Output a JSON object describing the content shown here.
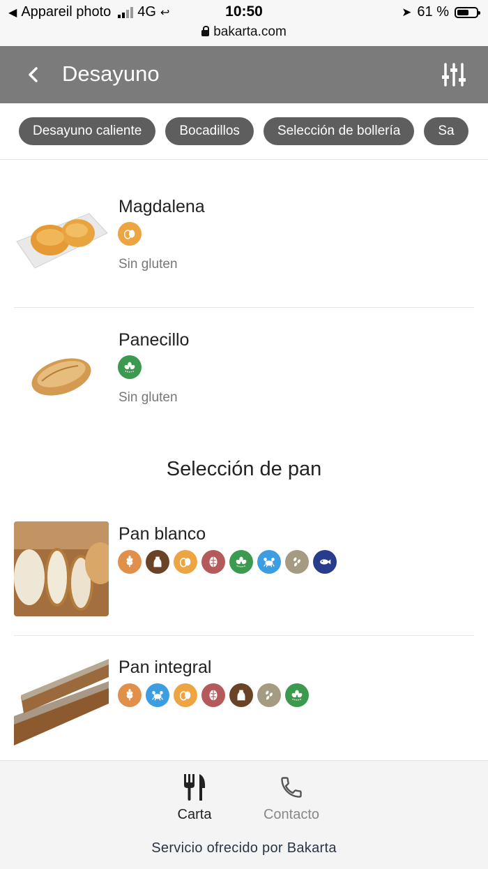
{
  "status_bar": {
    "carrier": "Appareil photo",
    "network": "4G",
    "time": "10:50",
    "battery": "61 %",
    "battery_level": 0.61,
    "url": "bakarta.com"
  },
  "header": {
    "title": "Desayuno"
  },
  "chips": [
    "Desayuno caliente",
    "Bocadillos",
    "Selección de bollería",
    "Sa"
  ],
  "items_top": [
    {
      "name": "Magdalena",
      "note": "Sin gluten",
      "allergens": [
        "egg"
      ]
    },
    {
      "name": "Panecillo",
      "note": "Sin gluten",
      "allergens": [
        "lupin"
      ]
    }
  ],
  "section_title": "Selección de pan",
  "items_pan": [
    {
      "name": "Pan blanco",
      "allergens": [
        "gluten",
        "milk",
        "egg",
        "nuts",
        "lupin",
        "crustacean",
        "sesame",
        "fish"
      ]
    },
    {
      "name": "Pan integral",
      "allergens": [
        "gluten",
        "crustacean",
        "egg",
        "nuts",
        "milk",
        "sesame",
        "lupin"
      ]
    }
  ],
  "allergen_colors": {
    "gluten": "#e0904a",
    "milk": "#6a4226",
    "egg": "#eda542",
    "nuts": "#b55a5a",
    "lupin": "#3c9a4e",
    "crustacean": "#3c9ee0",
    "sesame": "#a49b82",
    "fish": "#283c8e"
  },
  "bottom_nav": {
    "carta": "Carta",
    "contacto": "Contacto",
    "footer": "Servicio ofrecido por Bakarta"
  }
}
